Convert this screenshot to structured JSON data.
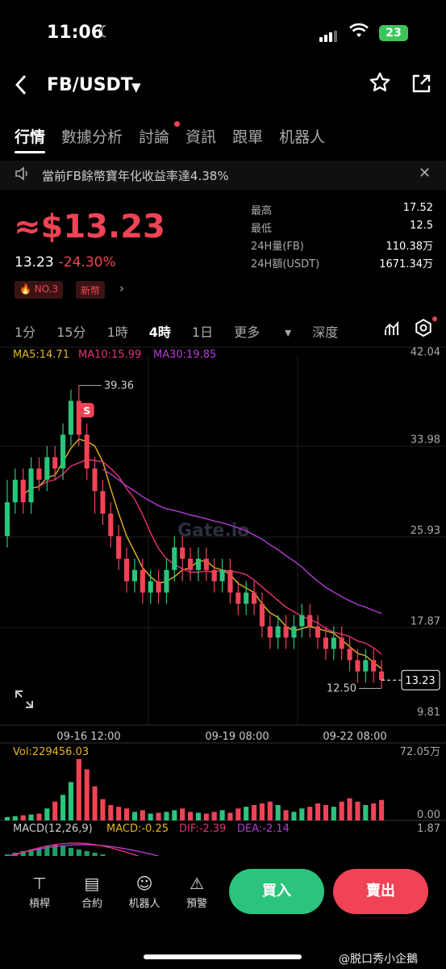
{
  "status": {
    "time": "11:06",
    "battery": "23"
  },
  "header": {
    "pair": "FB/USDT"
  },
  "tabs": [
    "行情",
    "數據分析",
    "討論",
    "資訊",
    "跟單",
    "机器人"
  ],
  "notice": {
    "text": "當前FB餘幣寶年化收益率達4.38%"
  },
  "ticker": {
    "price": "≈$13.23",
    "last": "13.23",
    "change": "-24.30%",
    "rank": "NO.3",
    "tag": "新幣",
    "stats": [
      {
        "label": "最高",
        "value": "17.52"
      },
      {
        "label": "最低",
        "value": "12.5"
      },
      {
        "label": "24H量(FB)",
        "value": "110.38万"
      },
      {
        "label": "24H額(USDT)",
        "value": "1671.34万"
      }
    ]
  },
  "intervals": {
    "items": [
      "1分",
      "15分",
      "1時",
      "4時",
      "1日"
    ],
    "more": "更多",
    "depth": "深度",
    "active": "4時"
  },
  "chart_data": {
    "type": "candlestick",
    "ma_legend": {
      "ma5": "MA5:14.71",
      "ma10": "MA10:15.99",
      "ma30": "MA30:19.85"
    },
    "y_ticks": [
      "42.04",
      "33.98",
      "25.93",
      "17.87",
      "9.81"
    ],
    "ylim": [
      9.81,
      42.04
    ],
    "x_ticks": [
      "09-16 12:00",
      "09-19 08:00",
      "09-22 08:00"
    ],
    "high_label": "39.36",
    "low_label": "12.50",
    "current_price": "13.23",
    "watermark": "Gate.io",
    "sell_marker": "S",
    "candles": [
      [
        26,
        29,
        25,
        31
      ],
      [
        29,
        31,
        28,
        32
      ],
      [
        31,
        29,
        28,
        32
      ],
      [
        29,
        32,
        28,
        33
      ],
      [
        32,
        31,
        30,
        33
      ],
      [
        31,
        33,
        30,
        34
      ],
      [
        33,
        32,
        31,
        34
      ],
      [
        32,
        35,
        31,
        36
      ],
      [
        35,
        38,
        34,
        39
      ],
      [
        38,
        35,
        34,
        39.36
      ],
      [
        35,
        32,
        31,
        36
      ],
      [
        32,
        30,
        28,
        33
      ],
      [
        30,
        28,
        27,
        31
      ],
      [
        28,
        26,
        25,
        29
      ],
      [
        26,
        24,
        23,
        27
      ],
      [
        24,
        22,
        21,
        25
      ],
      [
        22,
        23,
        21,
        24
      ],
      [
        23,
        21,
        20,
        24
      ],
      [
        21,
        22,
        20,
        23
      ],
      [
        22,
        21,
        20,
        23
      ],
      [
        21,
        23,
        20,
        24
      ],
      [
        23,
        25,
        22,
        26
      ],
      [
        25,
        24,
        22,
        26
      ],
      [
        24,
        23,
        22,
        25
      ],
      [
        23,
        24,
        22,
        25
      ],
      [
        24,
        23,
        22,
        25
      ],
      [
        23,
        22,
        21,
        24
      ],
      [
        22,
        23,
        21,
        24
      ],
      [
        23,
        21,
        20,
        24
      ],
      [
        21,
        20,
        19,
        22
      ],
      [
        20,
        21,
        19,
        22
      ],
      [
        21,
        20,
        19,
        22
      ],
      [
        20,
        18,
        17,
        21
      ],
      [
        18,
        17,
        16,
        19
      ],
      [
        17,
        18,
        16,
        19
      ],
      [
        18,
        17,
        16,
        19
      ],
      [
        17,
        18,
        16,
        19
      ],
      [
        18,
        19,
        17,
        20
      ],
      [
        19,
        18,
        17,
        20
      ],
      [
        18,
        17,
        16,
        19
      ],
      [
        17,
        16,
        15,
        18
      ],
      [
        16,
        17,
        15,
        18
      ],
      [
        17,
        16,
        15,
        18
      ],
      [
        16,
        15,
        14,
        17
      ],
      [
        15,
        14,
        13,
        16
      ],
      [
        14,
        15,
        13,
        16
      ],
      [
        15,
        14,
        13,
        16
      ],
      [
        14,
        13.23,
        12.5,
        15
      ]
    ],
    "vol_label": "Vol:229456.03",
    "vol_ticks": [
      "72.05万",
      "0.00"
    ],
    "volumes": [
      4,
      5,
      6,
      7,
      8,
      14,
      22,
      30,
      45,
      72,
      60,
      40,
      25,
      18,
      16,
      14,
      10,
      12,
      8,
      9,
      10,
      12,
      14,
      10,
      9,
      8,
      10,
      12,
      9,
      14,
      16,
      18,
      20,
      22,
      18,
      12,
      10,
      14,
      16,
      20,
      18,
      16,
      22,
      26,
      22,
      18,
      20,
      24
    ],
    "macd_label": "MACD(12,26,9)",
    "macd_value": "MACD:-0.25",
    "dif": "DIF:-2.39",
    "dea": "DEA:-2.14",
    "macd_top": "1.87"
  },
  "bottom": {
    "items": [
      "槓桿",
      "合約",
      "机器人",
      "預警"
    ],
    "buy": "買入",
    "sell": "賣出",
    "credit": "@脱口秀小企鵝"
  }
}
